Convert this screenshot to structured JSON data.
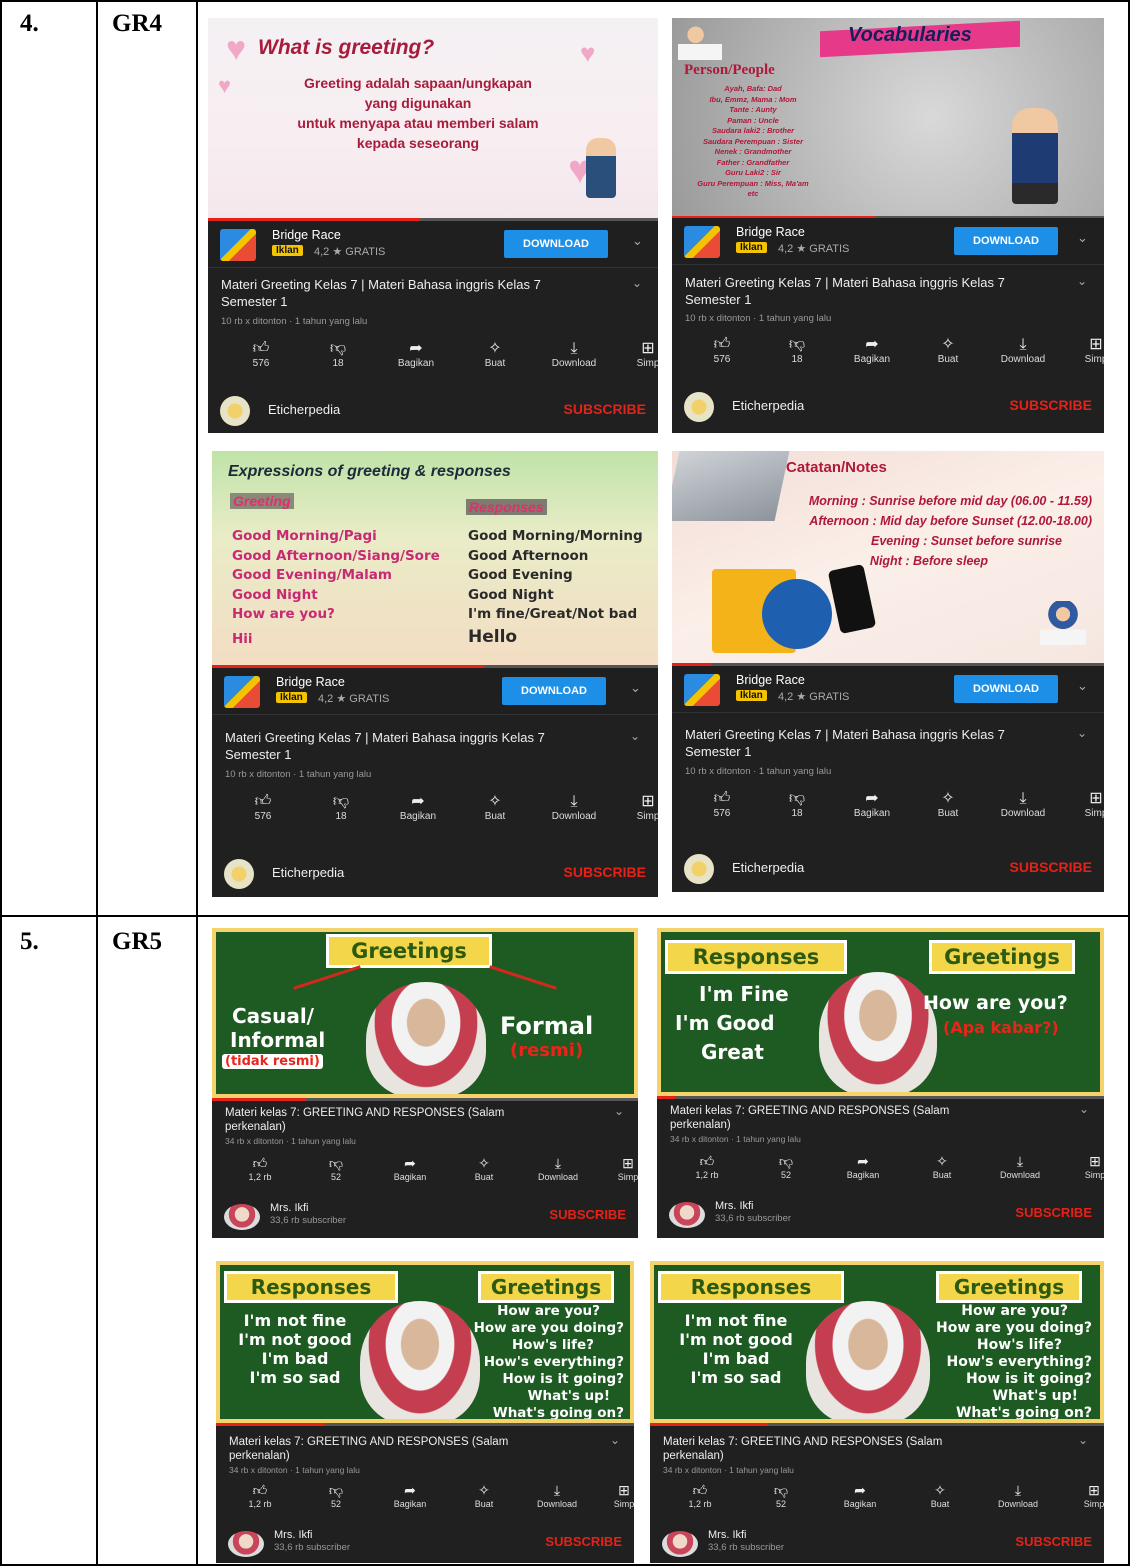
{
  "rows": [
    {
      "number": "4.",
      "code": "GR4"
    },
    {
      "number": "5.",
      "code": "GR5"
    }
  ],
  "gr4": {
    "app": {
      "name": "Bridge Race",
      "ad_badge": "Iklan",
      "rating": "4,2 ★ GRATIS",
      "download": "DOWNLOAD"
    },
    "video": {
      "title_line1": "Materi Greeting Kelas 7 | Materi Bahasa inggris Kelas 7",
      "title_line2": "Semester 1",
      "meta": "10 rb x ditonton · 1 tahun yang lalu",
      "likes": "576",
      "dislikes": "18",
      "share": "Bagikan",
      "create": "Buat",
      "download": "Download",
      "simpan": "Simp",
      "channel": "Eticherpedia",
      "subscribe": "SUBSCRIBE"
    },
    "thumb1": {
      "heading": "What is greeting?",
      "body": [
        "Greeting adalah sapaan/ungkapan",
        "yang digunakan",
        "untuk menyapa atau memberi salam",
        "kepada seseorang"
      ]
    },
    "thumb2": {
      "heading": "Vocabularies",
      "sub": "Person/People",
      "items": [
        "Ayah, Bafa: Dad",
        "Ibu, Emmz, Mama : Mom",
        "Tante : Aunty",
        "Paman : Uncle",
        "Saudara laki2 : Brother",
        "Saudara Perempuan : Sister",
        "Nenek : Grandmother",
        "Father : Grandfather",
        "Guru Laki2 : Sir",
        "Guru Perempuan : Miss, Ma'am",
        "etc"
      ]
    },
    "thumb3": {
      "heading": "Expressions of greeting & responses",
      "greeting_label": "Greeting",
      "responses_label": "Responses",
      "greetings": [
        "Good Morning/Pagi",
        "Good Afternoon/Siang/Sore",
        "Good Evening/Malam",
        "Good Night",
        "How are you?",
        "Hii"
      ],
      "responses": [
        "Good Morning/Morning",
        "Good Afternoon",
        "Good Evening",
        "Good Night",
        "I'm fine/Great/Not bad",
        "Hello"
      ]
    },
    "thumb4": {
      "heading": "Catatan/Notes",
      "lines": [
        "Morning : Sunrise before mid day (06.00 - 11.59)",
        "Afternoon : Mid day before Sunset (12.00-18.00)",
        "Evening : Sunset before sunrise",
        "Night : Before sleep"
      ]
    }
  },
  "gr5": {
    "video": {
      "title_line1": "Materi kelas 7: GREETING AND RESPONSES (Salam",
      "title_line2": "perkenalan)",
      "meta": "34 rb x ditonton · 1 tahun yang lalu",
      "likes": "1,2 rb",
      "dislikes": "52",
      "share": "Bagikan",
      "create": "Buat",
      "download": "Download",
      "simpan": "Simp",
      "channel": "Mrs. Ikfi",
      "subscribers": "33,6 rb subscriber",
      "subscribe": "SUBSCRIBE"
    },
    "thumb1": {
      "greetings": "Greetings",
      "left1": "Casual/",
      "left2": "Informal",
      "left3": "(tidak resmi)",
      "right1": "Formal",
      "right2": "(resmi)"
    },
    "thumb2": {
      "responses": "Responses",
      "greetings": "Greetings",
      "left": [
        "I'm Fine",
        "I'm Good",
        "Great"
      ],
      "right1": "How are you?",
      "right2": "(Apa kabar?)"
    },
    "thumb3": {
      "responses": "Responses",
      "greetings": "Greetings",
      "left": [
        "I'm not fine",
        "I'm not good",
        "I'm bad",
        "I'm so sad"
      ],
      "right": [
        "How are you?",
        "How are you doing?",
        "How's life?",
        "How's everything?",
        "How is it going?",
        "What's up!",
        "What's going on?"
      ]
    }
  },
  "colors": {
    "youtube_red": "#e62117",
    "download_blue": "#1e8fe6",
    "ad_yellow": "#f5c400",
    "board_green": "#1d5b22"
  },
  "progress": {
    "gr4_fraction": 0.47,
    "gr5_fraction": 0.22
  }
}
